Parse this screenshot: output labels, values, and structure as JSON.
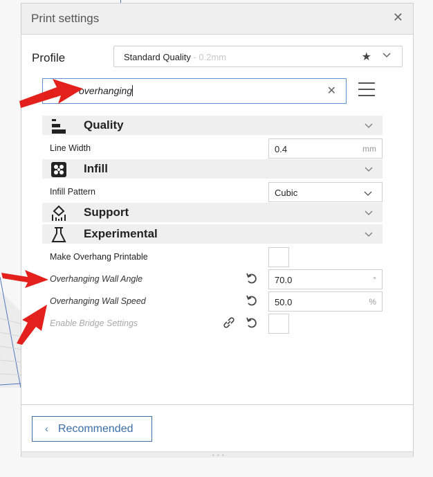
{
  "window": {
    "title": "Print settings",
    "close_icon": "close-icon"
  },
  "profile": {
    "label": "Profile",
    "name": "Standard Quality",
    "subtitle": " - 0.2mm"
  },
  "search": {
    "value": "overhanging"
  },
  "categories": [
    {
      "label": "Quality",
      "icon": "quality-layers-icon"
    },
    {
      "label": "Infill",
      "icon": "infill-pattern-icon"
    },
    {
      "label": "Support",
      "icon": "support-icon"
    },
    {
      "label": "Experimental",
      "icon": "flask-icon"
    }
  ],
  "settings": {
    "line_width": {
      "label": "Line Width",
      "value": "0.4",
      "unit": "mm"
    },
    "infill_pattern": {
      "label": "Infill Pattern",
      "value": "Cubic"
    },
    "make_overhang_printable": {
      "label": "Make Overhang Printable",
      "checked": false
    },
    "overhanging_wall_angle": {
      "label": "Overhanging Wall Angle",
      "value": "70.0",
      "unit": "°"
    },
    "overhanging_wall_speed": {
      "label": "Overhanging Wall Speed",
      "value": "50.0",
      "unit": "%"
    },
    "enable_bridge_settings": {
      "label": "Enable Bridge Settings",
      "checked": false
    }
  },
  "footer": {
    "recommended_label": "Recommended"
  },
  "colors": {
    "accent": "#3a6fa8",
    "search_border": "#5e93cf",
    "annotation_arrow": "#e3201b"
  }
}
